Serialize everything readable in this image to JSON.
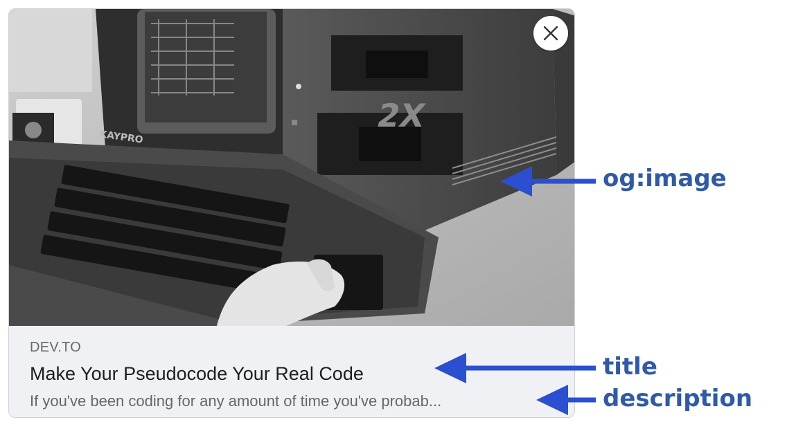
{
  "card": {
    "domain": "DEV.TO",
    "title": "Make Your Pseudocode Your Real Code",
    "description": "If you've been coding for any amount of time you've probab..."
  },
  "annotations": {
    "image_label": "og:image",
    "title_label": "title",
    "description_label": "description"
  },
  "image": {
    "keyboard_brand": "KAYPRO",
    "badge": "2X"
  },
  "colors": {
    "annotation": "#2f5aa8",
    "arrow": "#2a4fd0",
    "card_background": "#f0f1f5"
  },
  "icons": {
    "close": "close-icon"
  }
}
